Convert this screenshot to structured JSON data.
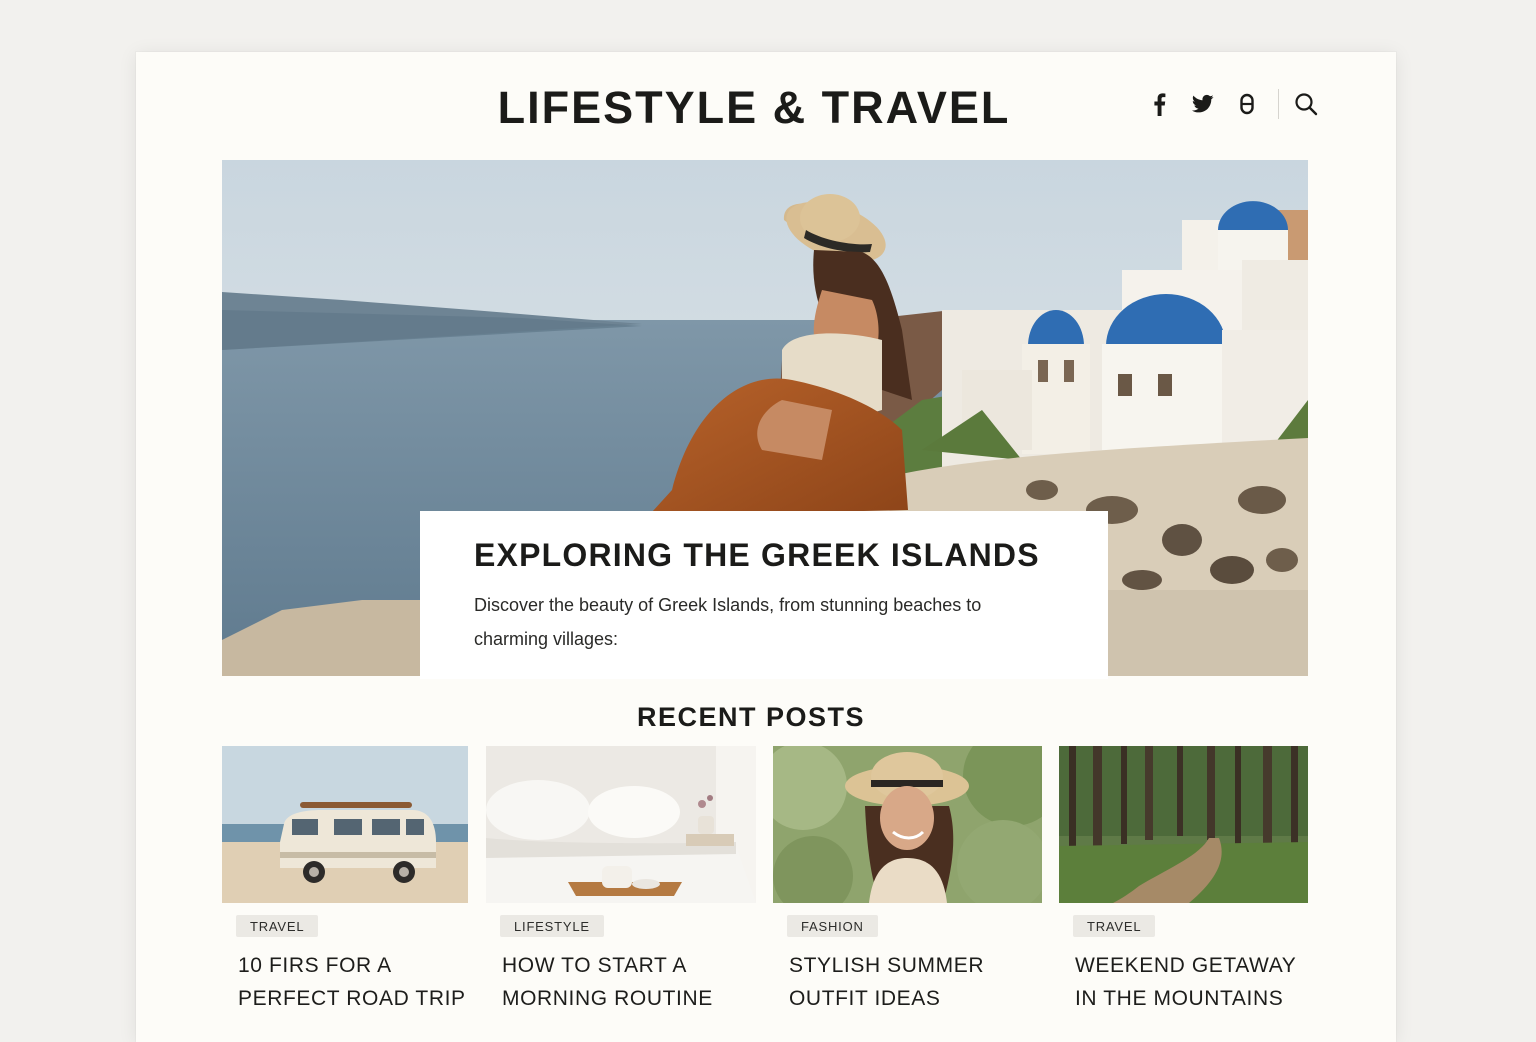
{
  "header": {
    "site_title": "LIFESTYLE & TRAVEL",
    "social_icons": [
      "facebook-icon",
      "twitter-icon",
      "instagram-icon"
    ],
    "search_icon": "search-icon"
  },
  "hero": {
    "title": "EXPLORING THE GREEK ISLANDS",
    "excerpt": "Discover the beauty of Greek Islands, from stunning beaches to charming villages:"
  },
  "recent_posts": {
    "heading": "RECENT POSTS",
    "items": [
      {
        "category": "TRAVEL",
        "title": "10 FIRS FOR A PERFECT ROAD TRIP"
      },
      {
        "category": "LIFESTYLE",
        "title": "HOW TO START A MORNING ROUTINE"
      },
      {
        "category": "FASHION",
        "title": "STYLISH SUMMER OUTFIT IDEAS"
      },
      {
        "category": "TRAVEL",
        "title": "WEEKEND GETAWAY IN THE MOUNTAINS"
      }
    ]
  },
  "colors": {
    "background": "#f2f1ee",
    "page": "#fdfcf8",
    "text": "#1b1b19",
    "tag_bg": "#ebe9e4",
    "dome_blue": "#2f6db3"
  }
}
